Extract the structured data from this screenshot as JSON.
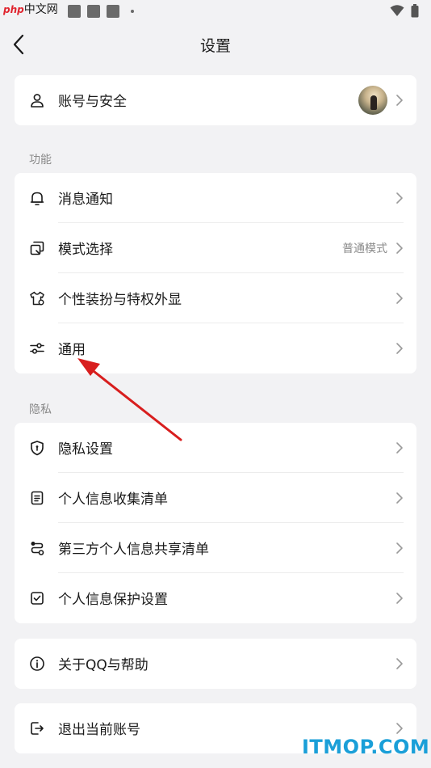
{
  "watermark_top": {
    "prefix": "php",
    "text": "中文网"
  },
  "header": {
    "title": "设置"
  },
  "account": {
    "label": "账号与安全"
  },
  "sections": {
    "features": "功能",
    "privacy": "隐私"
  },
  "features": {
    "notifications": "消息通知",
    "mode": "模式选择",
    "mode_value": "普通模式",
    "personalization": "个性装扮与特权外显",
    "general": "通用"
  },
  "privacy": {
    "privacy_settings": "隐私设置",
    "info_collection": "个人信息收集清单",
    "third_party": "第三方个人信息共享清单",
    "protection": "个人信息保护设置"
  },
  "about": {
    "label": "关于QQ与帮助"
  },
  "logout": {
    "label": "退出当前账号"
  },
  "watermark_bottom": "ITMOP.COM",
  "colors": {
    "background": "#f2f2f4",
    "card": "#ffffff",
    "annotation_arrow": "#d81e1e",
    "watermark": "#1a9fd8"
  }
}
